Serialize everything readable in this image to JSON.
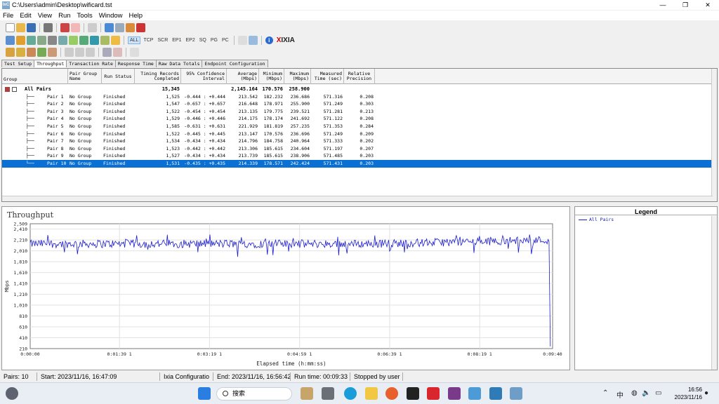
{
  "window": {
    "title": "C:\\Users\\admin\\Desktop\\wificard.tst",
    "app_icon_text": "IxC",
    "controls": [
      "—",
      "❐",
      "✕"
    ]
  },
  "menu": [
    "File",
    "Edit",
    "View",
    "Run",
    "Tools",
    "Window",
    "Help"
  ],
  "toolbar2": {
    "filters": [
      "ALL",
      "TCP",
      "SCR",
      "EP1",
      "EP2",
      "SQ",
      "PG",
      "PC"
    ],
    "brand_x": "X",
    "brand": "IXIA"
  },
  "tabs": [
    "Test Setup",
    "Throughput",
    "Transaction Rate",
    "Response Time",
    "Raw Data Totals",
    "Endpoint Configuration"
  ],
  "grid": {
    "headers": [
      "Group",
      "Pair Group Name",
      "Run Status",
      "Timing Records Completed",
      "95% Confidence Interval",
      "Average (Mbps)",
      "Minimum (Mbps)",
      "Maximum (Mbps)",
      "Measured Time (sec)",
      "Relative Precision"
    ],
    "summary": {
      "label": "All Pairs",
      "records": "15,345",
      "average": "2,145.164",
      "minimum": "170.576",
      "maximum": "258.900"
    },
    "rows": [
      {
        "pair": "Pair 1",
        "group": "No Group",
        "status": "Finished",
        "records": "1,525",
        "ci": "-0.444 : +0.444",
        "avg": "213.542",
        "min": "182.232",
        "max": "236.686",
        "time": "571.316",
        "prec": "0.208"
      },
      {
        "pair": "Pair 2",
        "group": "No Group",
        "status": "Finished",
        "records": "1,547",
        "ci": "-0.657 : +0.657",
        "avg": "216.648",
        "min": "178.971",
        "max": "255.900",
        "time": "571.249",
        "prec": "0.303"
      },
      {
        "pair": "Pair 3",
        "group": "No Group",
        "status": "Finished",
        "records": "1,522",
        "ci": "-0.454 : +0.454",
        "avg": "213.135",
        "min": "179.775",
        "max": "239.521",
        "time": "571.281",
        "prec": "0.213"
      },
      {
        "pair": "Pair 4",
        "group": "No Group",
        "status": "Finished",
        "records": "1,529",
        "ci": "-0.446 : +0.446",
        "avg": "214.175",
        "min": "178.174",
        "max": "241.692",
        "time": "571.122",
        "prec": "0.208"
      },
      {
        "pair": "Pair 5",
        "group": "No Group",
        "status": "Finished",
        "records": "1,585",
        "ci": "-0.631 : +0.631",
        "avg": "221.929",
        "min": "181.819",
        "max": "257.235",
        "time": "571.353",
        "prec": "0.284"
      },
      {
        "pair": "Pair 6",
        "group": "No Group",
        "status": "Finished",
        "records": "1,522",
        "ci": "-0.445 : +0.445",
        "avg": "213.147",
        "min": "170.576",
        "max": "236.696",
        "time": "571.249",
        "prec": "0.209"
      },
      {
        "pair": "Pair 7",
        "group": "No Group",
        "status": "Finished",
        "records": "1,534",
        "ci": "-0.434 : +0.434",
        "avg": "214.796",
        "min": "184.758",
        "max": "240.964",
        "time": "571.333",
        "prec": "0.202"
      },
      {
        "pair": "Pair 8",
        "group": "No Group",
        "status": "Finished",
        "records": "1,523",
        "ci": "-0.442 : +0.442",
        "avg": "213.306",
        "min": "185.615",
        "max": "234.604",
        "time": "571.197",
        "prec": "0.207"
      },
      {
        "pair": "Pair 9",
        "group": "No Group",
        "status": "Finished",
        "records": "1,527",
        "ci": "-0.434 : +0.434",
        "avg": "213.739",
        "min": "185.615",
        "max": "238.906",
        "time": "571.485",
        "prec": "0.203"
      },
      {
        "pair": "Pair 10",
        "group": "No Group",
        "status": "Finished",
        "records": "1,531",
        "ci": "-0.435 : +0.435",
        "avg": "214.339",
        "min": "178.571",
        "max": "242.424",
        "time": "571.431",
        "prec": "0.203"
      }
    ]
  },
  "legend": {
    "title": "Legend",
    "items": [
      {
        "name": "All Pairs",
        "color": "#1a1ad0"
      }
    ]
  },
  "chart_data": {
    "type": "line",
    "title": "Throughput",
    "xlabel": "Elapsed time (h:mm:ss)",
    "ylabel": "Mbps",
    "x_ticks": [
      "0:00:00",
      "0:01:39 1",
      "0:03:19 1",
      "0:04:59 1",
      "0:06:39 1",
      "0:08:19 1",
      "0:09:40"
    ],
    "y_ticks": [
      "210",
      "410",
      "610",
      "810",
      "1,010",
      "1,210",
      "1,410",
      "1,610",
      "1,810",
      "2,010",
      "2,210",
      "2,410",
      "2,509"
    ],
    "ylim": [
      210,
      2509
    ],
    "xlim_sec": [
      0,
      580
    ],
    "grid": true,
    "series": [
      {
        "name": "All Pairs",
        "color": "#1a1ad0",
        "mean": 2140,
        "min": 1880,
        "max": 2310,
        "end_drop": 250,
        "note_shape": "noisy trace around ~2,140 Mbps throughout the run, slowly rising toward ~2,220 near the end, then drops sharply to ~250 at 0:09:40"
      }
    ]
  },
  "status": {
    "pairs": "Pairs: 10",
    "start": "Start: 2023/11/16, 16:47:09",
    "config": "Ixia Configuratio",
    "end": "End: 2023/11/16, 16:56:42",
    "runtime": "Run time: 00:09:33",
    "stopped": "Stopped by user"
  },
  "taskbar": {
    "search": "搜索",
    "ime": "中",
    "time": "16:56",
    "date": "2023/11/16"
  }
}
